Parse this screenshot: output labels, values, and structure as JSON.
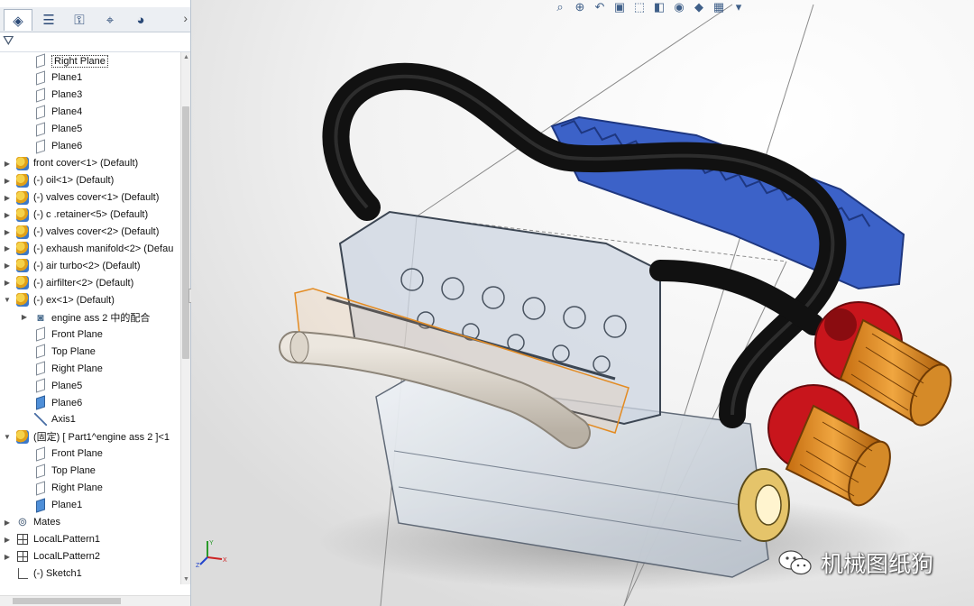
{
  "feature_tree": {
    "rows": [
      {
        "label": "Right Plane",
        "icon": "plane-icon",
        "indent": 1,
        "expander": "",
        "selected": true
      },
      {
        "label": "Plane1",
        "icon": "plane-icon",
        "indent": 1,
        "expander": ""
      },
      {
        "label": "Plane3",
        "icon": "plane-icon",
        "indent": 1,
        "expander": ""
      },
      {
        "label": "Plane4",
        "icon": "plane-icon",
        "indent": 1,
        "expander": ""
      },
      {
        "label": "Plane5",
        "icon": "plane-icon",
        "indent": 1,
        "expander": ""
      },
      {
        "label": "Plane6",
        "icon": "plane-icon",
        "indent": 1,
        "expander": ""
      },
      {
        "label": "front cover<1> (Default)",
        "icon": "part-icon",
        "indent": 0,
        "expander": "▶"
      },
      {
        "label": "(-) oil<1> (Default)",
        "icon": "part-icon",
        "indent": 0,
        "expander": "▶"
      },
      {
        "label": "(-) valves cover<1> (Default)",
        "icon": "part-icon",
        "indent": 0,
        "expander": "▶"
      },
      {
        "label": "(-) c .retainer<5> (Default)",
        "icon": "part-icon",
        "indent": 0,
        "expander": "▶"
      },
      {
        "label": "(-) valves cover<2> (Default)",
        "icon": "part-icon",
        "indent": 0,
        "expander": "▶"
      },
      {
        "label": "(-) exhaush manifold<2> (Defau",
        "icon": "part-icon",
        "indent": 0,
        "expander": "▶"
      },
      {
        "label": "(-) air turbo<2> (Default)",
        "icon": "part-icon",
        "indent": 0,
        "expander": "▶"
      },
      {
        "label": "(-) airfilter<2> (Default)",
        "icon": "part-icon",
        "indent": 0,
        "expander": "▶"
      },
      {
        "label": "(-) ex<1> (Default)",
        "icon": "part-icon",
        "indent": 0,
        "expander": "▼"
      },
      {
        "label": "engine ass 2 中的配合",
        "icon": "mate-group-icon",
        "indent": 1,
        "expander": "▶"
      },
      {
        "label": "Front Plane",
        "icon": "plane-icon",
        "indent": 1,
        "expander": ""
      },
      {
        "label": "Top Plane",
        "icon": "plane-icon",
        "indent": 1,
        "expander": ""
      },
      {
        "label": "Right Plane",
        "icon": "plane-icon",
        "indent": 1,
        "expander": ""
      },
      {
        "label": "Plane5",
        "icon": "plane-icon",
        "indent": 1,
        "expander": ""
      },
      {
        "label": "Plane6",
        "icon": "plane-icon-blue",
        "indent": 1,
        "expander": ""
      },
      {
        "label": "Axis1",
        "icon": "axis-icon",
        "indent": 1,
        "expander": ""
      },
      {
        "label": "(固定) [ Part1^engine ass 2 ]<1",
        "icon": "part-icon",
        "indent": 0,
        "expander": "▼"
      },
      {
        "label": "Front Plane",
        "icon": "plane-icon",
        "indent": 1,
        "expander": ""
      },
      {
        "label": "Top Plane",
        "icon": "plane-icon",
        "indent": 1,
        "expander": ""
      },
      {
        "label": "Right Plane",
        "icon": "plane-icon",
        "indent": 1,
        "expander": ""
      },
      {
        "label": "Plane1",
        "icon": "plane-icon-blue",
        "indent": 1,
        "expander": ""
      },
      {
        "label": "Mates",
        "icon": "mates-icon",
        "indent": 0,
        "expander": "▶"
      },
      {
        "label": "LocalLPattern1",
        "icon": "pattern-icon",
        "indent": 0,
        "expander": "▶"
      },
      {
        "label": "LocalLPattern2",
        "icon": "pattern-icon",
        "indent": 0,
        "expander": "▶"
      },
      {
        "label": "(-) Sketch1",
        "icon": "sketch-icon",
        "indent": 0,
        "expander": ""
      }
    ]
  },
  "panel_tabs": [
    {
      "name": "feature-manager-tab",
      "icon": "assembly-icon",
      "glyph": "◈",
      "active": true
    },
    {
      "name": "property-manager-tab",
      "icon": "properties-icon",
      "glyph": "☰"
    },
    {
      "name": "configuration-manager-tab",
      "icon": "configuration-icon",
      "glyph": "⚿"
    },
    {
      "name": "dimxpert-tab",
      "icon": "crosshair-icon",
      "glyph": "⌖"
    },
    {
      "name": "display-manager-tab",
      "icon": "appearance-icon",
      "glyph": "◕"
    }
  ],
  "tabs_more": "›",
  "filter_glyph": "⛛",
  "heads_up_toolbar": [
    "zoom-to-fit-icon",
    "zoom-area-icon",
    "previous-view-icon",
    "section-view-icon",
    "view-orientation-icon",
    "display-style-icon",
    "hide-show-icon",
    "edit-appearance-icon",
    "scene-icon",
    "view-settings-icon"
  ],
  "triad": {
    "x_label": "X",
    "y_label": "Y",
    "z_label": "Z"
  },
  "watermark": {
    "text": "机械图纸狗"
  }
}
